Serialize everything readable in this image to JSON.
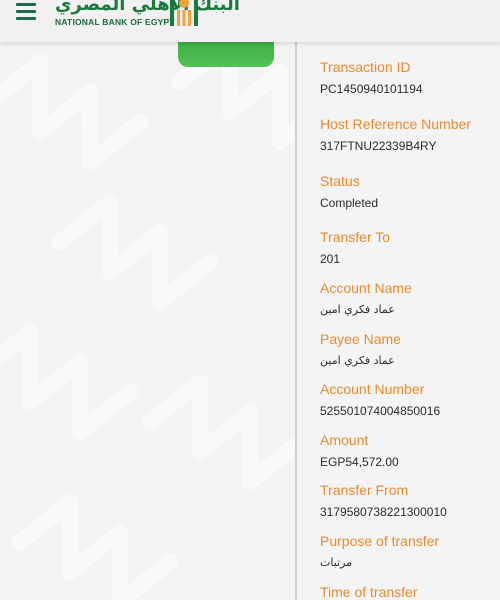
{
  "header": {
    "menu_icon": "hamburger-menu-icon",
    "logo_arabic": "البنك الأهلي المصري",
    "logo_english": "NATIONAL BANK OF EGYPT",
    "brand_green": "#1a7a3c",
    "accent_orange": "#e88a2e"
  },
  "details": {
    "fields": [
      {
        "label": "Transaction ID",
        "value": "PC1450940101194"
      },
      {
        "label": "Host Reference Number",
        "value": "317FTNU22339B4RY"
      },
      {
        "label": "Status",
        "value": "Completed"
      },
      {
        "label": "Transfer To",
        "value": "201"
      },
      {
        "label": "Account Name",
        "value": "عماد فكري امين"
      },
      {
        "label": "Payee Name",
        "value": "عماد فكري امين"
      },
      {
        "label": "Account Number",
        "value": "525501074004850016"
      },
      {
        "label": "Amount",
        "value": "EGP54,572.00"
      },
      {
        "label": "Transfer From",
        "value": "3179580738221300010"
      },
      {
        "label": "Purpose of transfer",
        "value": "مرتبات"
      },
      {
        "label": "Time of transfer",
        "value": ""
      }
    ]
  }
}
